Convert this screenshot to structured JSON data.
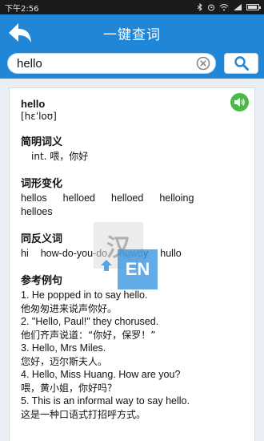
{
  "status_bar": {
    "time": "下午2:56",
    "icons": [
      "bluetooth-icon",
      "alarm-icon",
      "wifi-icon",
      "signal-icon",
      "battery-icon"
    ]
  },
  "app_bar": {
    "title": "一键查词"
  },
  "search": {
    "value": "hello",
    "placeholder": ""
  },
  "entry": {
    "word": "hello",
    "phonetic": "[hɛˈloʊ]",
    "definition_title": "简明词义",
    "definition": "int. 喂，你好",
    "inflection_title": "词形变化",
    "inflections": [
      "hellos",
      "helloed",
      "helloed",
      "helloing",
      "helloes"
    ],
    "synonym_title": "同反义词",
    "synonyms": [
      "hi",
      "how-do-you-do",
      "howdy",
      "hullo"
    ],
    "example_title": "参考例句",
    "examples": [
      {
        "en": "1. He popped in to say hello.",
        "zh": "他匆匆进来说声你好。"
      },
      {
        "en": "2. \"Hello, Paul!\" they chorused.",
        "zh": "他们齐声说道：“你好，保罗！”"
      },
      {
        "en": "3. Hello, Mrs Miles.",
        "zh": "您好，迈尔斯夫人。"
      },
      {
        "en": "4. Hello, Miss Huang. How are you?",
        "zh": "喂，黄小姐，你好吗？"
      },
      {
        "en": "5. This is an informal way to say hello.",
        "zh": "这是一种口语式打招呼方式。"
      }
    ]
  },
  "watermark": {
    "cn": "汉",
    "en": "EN"
  },
  "colors": {
    "primary": "#1f86d8",
    "speaker": "#4cb848"
  }
}
